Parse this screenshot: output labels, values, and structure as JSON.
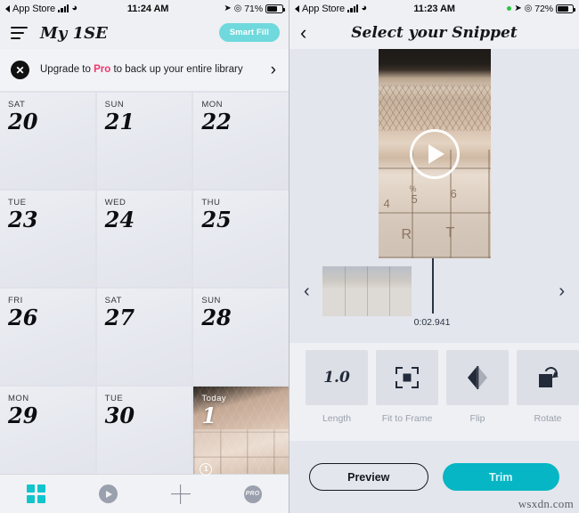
{
  "left": {
    "status_bar": {
      "back_label": "App Store",
      "signal_icon": "signal-bars-icon",
      "wifi_icon": "wifi-icon",
      "time": "11:24 AM",
      "location_icon": "location-arrow-icon",
      "alarm_icon": "alarm-icon",
      "battery_percent": "71%",
      "battery_icon": "battery-icon"
    },
    "appbar": {
      "menu_icon": "hamburger-menu-icon",
      "title": "My 1SE",
      "smart_fill_label": "Smart Fill"
    },
    "banner": {
      "close_icon": "close-icon",
      "text_before": "Upgrade to ",
      "highlight": "Pro",
      "text_after": " to back up your entire library",
      "chevron_icon": "chevron-right-icon"
    },
    "calendar": {
      "cells": [
        {
          "dow": "SAT",
          "day": "20",
          "photo": false
        },
        {
          "dow": "SUN",
          "day": "21",
          "photo": false
        },
        {
          "dow": "MON",
          "day": "22",
          "photo": false
        },
        {
          "dow": "TUE",
          "day": "23",
          "photo": false
        },
        {
          "dow": "WED",
          "day": "24",
          "photo": false
        },
        {
          "dow": "THU",
          "day": "25",
          "photo": false
        },
        {
          "dow": "FRI",
          "day": "26",
          "photo": false
        },
        {
          "dow": "SAT",
          "day": "27",
          "photo": false
        },
        {
          "dow": "SUN",
          "day": "28",
          "photo": false
        },
        {
          "dow": "MON",
          "day": "29",
          "photo": false
        },
        {
          "dow": "TUE",
          "day": "30",
          "photo": false
        },
        {
          "dow": "Today",
          "day": "1",
          "photo": true,
          "badge": "1"
        }
      ]
    },
    "tabbar": {
      "items": [
        {
          "icon": "grid-icon",
          "active": true
        },
        {
          "icon": "play-circle-icon",
          "active": false
        },
        {
          "icon": "plus-icon",
          "active": false
        },
        {
          "icon": "pro-badge-icon",
          "label": "PRO",
          "active": false
        }
      ]
    }
  },
  "right": {
    "status_bar": {
      "back_label": "App Store",
      "signal_icon": "signal-bars-icon",
      "wifi_icon": "wifi-icon",
      "time": "11:23 AM",
      "recording_dot": "green-recording-dot-icon",
      "location_icon": "location-arrow-icon",
      "alarm_icon": "alarm-icon",
      "battery_percent": "72%",
      "battery_icon": "battery-icon"
    },
    "navbar": {
      "back_icon": "chevron-left-icon",
      "title": "Select your Snippet"
    },
    "video": {
      "play_icon": "play-button-icon",
      "key_labels": [
        "%",
        "5",
        "6",
        "4",
        "R",
        "T"
      ]
    },
    "timeline": {
      "prev_icon": "chevron-left-icon",
      "next_icon": "chevron-right-icon",
      "current_time": "0:02.941"
    },
    "tools": [
      {
        "label": "Length",
        "icon": "length-icon",
        "value": "1.0"
      },
      {
        "label": "Fit to Frame",
        "icon": "fit-to-frame-icon"
      },
      {
        "label": "Flip",
        "icon": "flip-icon"
      },
      {
        "label": "Rotate",
        "icon": "rotate-icon"
      }
    ],
    "actions": {
      "preview_label": "Preview",
      "trim_label": "Trim"
    },
    "watermark": "wsxdn.com"
  },
  "colors": {
    "teal": "#12c4cc",
    "trim_button": "#06b6c4",
    "smart_fill": "#6fd9dd",
    "pro_pink": "#f0356e",
    "panel_bg": "#eef0f4"
  }
}
